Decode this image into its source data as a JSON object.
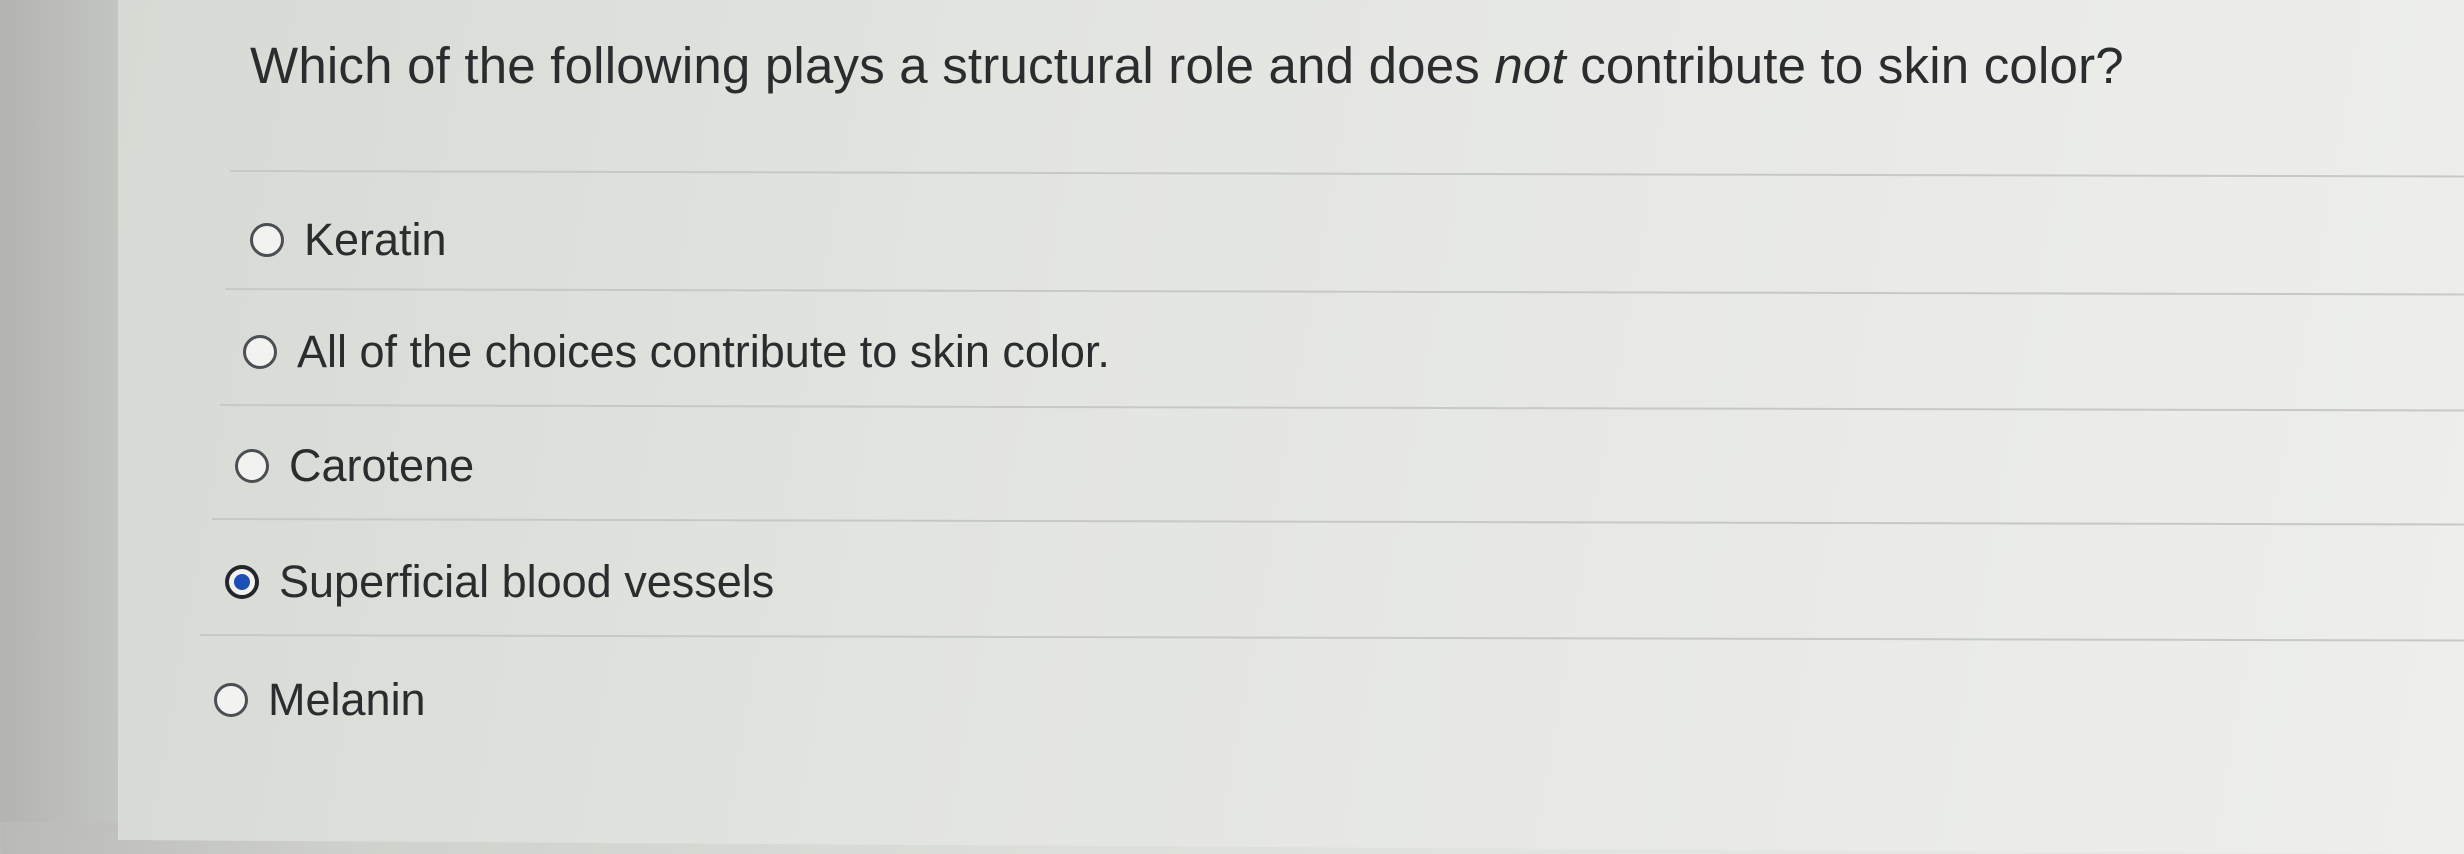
{
  "question": {
    "before": "Which of the following plays a structural role and does ",
    "emphasis": "not",
    "after": " contribute to skin color?"
  },
  "options": [
    {
      "label": "Keratin",
      "selected": false
    },
    {
      "label": "All of the choices contribute to skin color.",
      "selected": false
    },
    {
      "label": "Carotene",
      "selected": false
    },
    {
      "label": "Superficial blood vessels",
      "selected": true
    },
    {
      "label": "Melanin",
      "selected": false
    }
  ],
  "colors": {
    "selected_radio": "#1d4fb7",
    "text": "#2a2c2e"
  }
}
